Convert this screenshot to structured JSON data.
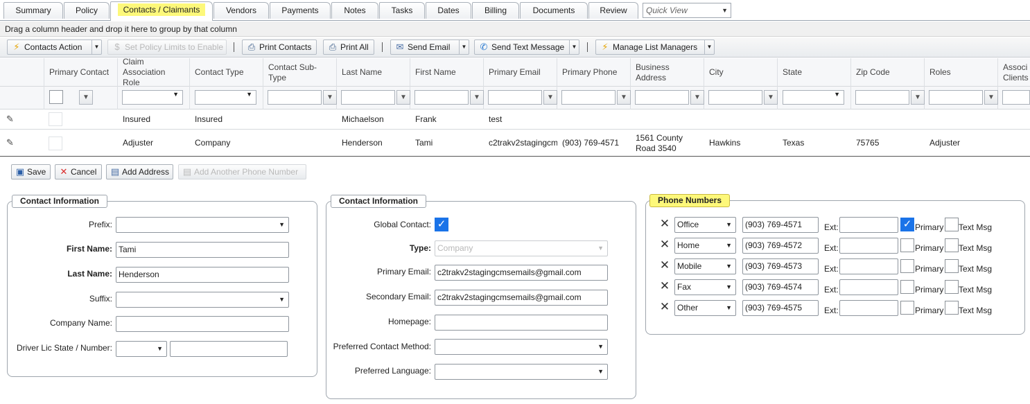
{
  "tabs": [
    "Summary",
    "Policy",
    "Contacts / Claimants",
    "Vendors",
    "Payments",
    "Notes",
    "Tasks",
    "Dates",
    "Billing",
    "Documents",
    "Review"
  ],
  "quick_view": {
    "placeholder": "Quick View"
  },
  "group_hint": "Drag a column header and drop it here to group by that column",
  "toolbar": {
    "contacts_action": "Contacts Action",
    "set_policy_limits": "Set Policy Limits to Enable",
    "print_contacts": "Print Contacts",
    "print_all": "Print All",
    "send_email": "Send Email",
    "send_text": "Send Text Message",
    "manage_list": "Manage List Managers"
  },
  "grid": {
    "columns": [
      "Primary Contact",
      "Claim Association Role",
      "Contact Type",
      "Contact Sub-Type",
      "Last Name",
      "First Name",
      "Primary Email",
      "Primary Phone",
      "Business Address",
      "City",
      "State",
      "Zip Code",
      "Roles",
      "Associ Clients"
    ],
    "rows": [
      {
        "role": "Insured",
        "type": "Insured",
        "subtype": "",
        "last": "Michaelson",
        "first": "Frank",
        "email": "test",
        "phone": "",
        "address": "",
        "city": "",
        "state": "",
        "zip": "",
        "roles": ""
      },
      {
        "role": "Adjuster",
        "type": "Company",
        "subtype": "",
        "last": "Henderson",
        "first": "Tami",
        "email": "c2trakv2stagingcm",
        "phone": "(903) 769-4571",
        "address": "1561 County Road 3540",
        "city": "Hawkins",
        "state": "Texas",
        "zip": "75765",
        "roles": "Adjuster"
      }
    ]
  },
  "form_buttons": {
    "save": "Save",
    "cancel": "Cancel",
    "add_address": "Add Address",
    "add_phone": "Add Another Phone Number"
  },
  "contact_left": {
    "legend": "Contact Information",
    "prefix_label": "Prefix:",
    "prefix_value": "",
    "first_label": "First Name:",
    "first_value": "Tami",
    "last_label": "Last Name:",
    "last_value": "Henderson",
    "suffix_label": "Suffix:",
    "suffix_value": "",
    "company_label": "Company Name:",
    "company_value": "",
    "driver_label": "Driver Lic State / Number:",
    "driver_state": "",
    "driver_number": ""
  },
  "contact_right": {
    "legend": "Contact Information",
    "global_label": "Global Contact:",
    "global_checked": true,
    "type_label": "Type:",
    "type_value": "Company",
    "primary_email_label": "Primary Email:",
    "primary_email": "c2trakv2stagingcmsemails@gmail.com",
    "secondary_email_label": "Secondary Email:",
    "secondary_email": "c2trakv2stagingcmsemails@gmail.com",
    "homepage_label": "Homepage:",
    "homepage": "",
    "pref_method_label": "Preferred Contact Method:",
    "pref_method": "",
    "pref_lang_label": "Preferred Language:",
    "pref_lang": ""
  },
  "phones": {
    "legend": "Phone Numbers",
    "ext_label": "Ext:",
    "primary_label": "Primary",
    "textmsg_label": "Text Msg",
    "items": [
      {
        "type": "Office",
        "number": "(903) 769-4571",
        "ext": "",
        "primary": true,
        "text": false
      },
      {
        "type": "Home",
        "number": "(903) 769-4572",
        "ext": "",
        "primary": false,
        "text": false
      },
      {
        "type": "Mobile",
        "number": "(903) 769-4573",
        "ext": "",
        "primary": false,
        "text": false
      },
      {
        "type": "Fax",
        "number": "(903) 769-4574",
        "ext": "",
        "primary": false,
        "text": false
      },
      {
        "type": "Other",
        "number": "(903) 769-4575",
        "ext": "",
        "primary": false,
        "text": false
      }
    ]
  }
}
